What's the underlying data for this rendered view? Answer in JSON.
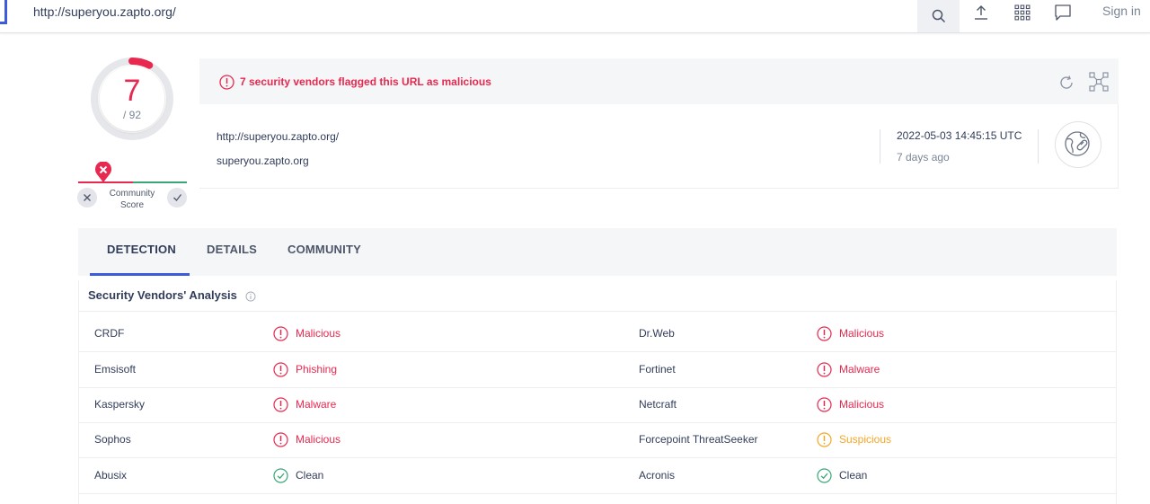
{
  "colors": {
    "malicious": "#e8284f",
    "suspicious": "#f5a623",
    "clean": "#3aa676",
    "accent": "#3b5bdb"
  },
  "topbar": {
    "url": "http://superyou.zapto.org/",
    "icons": [
      "search-icon",
      "upload-icon",
      "apps-grid-icon",
      "chat-icon"
    ],
    "signin_label": "Sign in"
  },
  "score": {
    "detections": "7",
    "total": "/ 92",
    "fraction": 0.076
  },
  "community": {
    "label_line1": "Community",
    "label_line2": "Score"
  },
  "banner": {
    "text": "7 security vendors flagged this URL as malicious"
  },
  "info": {
    "url": "http://superyou.zapto.org/",
    "host": "superyou.zapto.org",
    "date": "2022-05-03 14:45:15 UTC",
    "ago": "7 days ago"
  },
  "tabs": [
    {
      "label": "DETECTION",
      "active": true
    },
    {
      "label": "DETAILS",
      "active": false
    },
    {
      "label": "COMMUNITY",
      "active": false
    }
  ],
  "section": {
    "title": "Security Vendors' Analysis"
  },
  "rows": [
    {
      "left": {
        "vendor": "CRDF",
        "result": "Malicious",
        "status": "malicious"
      },
      "right": {
        "vendor": "Dr.Web",
        "result": "Malicious",
        "status": "malicious"
      }
    },
    {
      "left": {
        "vendor": "Emsisoft",
        "result": "Phishing",
        "status": "malicious"
      },
      "right": {
        "vendor": "Fortinet",
        "result": "Malware",
        "status": "malicious"
      }
    },
    {
      "left": {
        "vendor": "Kaspersky",
        "result": "Malware",
        "status": "malicious"
      },
      "right": {
        "vendor": "Netcraft",
        "result": "Malicious",
        "status": "malicious"
      }
    },
    {
      "left": {
        "vendor": "Sophos",
        "result": "Malicious",
        "status": "malicious"
      },
      "right": {
        "vendor": "Forcepoint ThreatSeeker",
        "result": "Suspicious",
        "status": "suspicious"
      }
    },
    {
      "left": {
        "vendor": "Abusix",
        "result": "Clean",
        "status": "clean"
      },
      "right": {
        "vendor": "Acronis",
        "result": "Clean",
        "status": "clean"
      }
    }
  ]
}
